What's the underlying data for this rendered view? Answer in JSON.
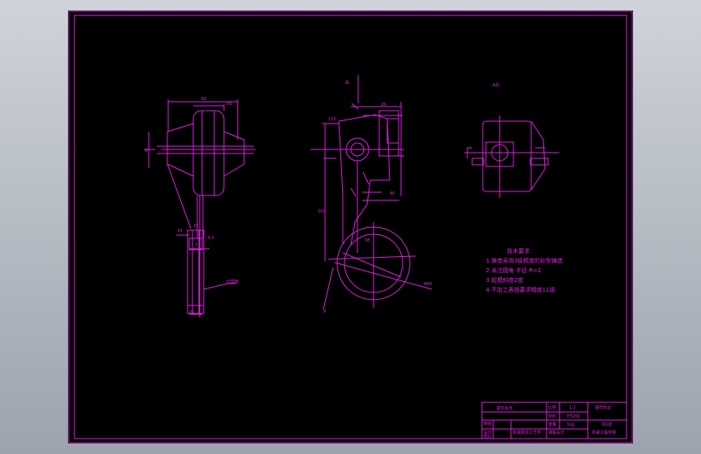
{
  "drawing": {
    "view_labels": {
      "section_a": "A",
      "view_a": "A向"
    },
    "dimensions": {
      "d_60": "60",
      "d_r5": "R5",
      "d_phi": "Φ",
      "d_14": "14",
      "d_15": "15",
      "d_3": "3",
      "d_6_5": "6.5",
      "d_25": "25",
      "d_26": "26",
      "d_100": "100",
      "d_120": "120",
      "d_40": "40",
      "d_38": "38",
      "d_phi_40": "Φ40",
      "d_r": "R",
      "plane_note": "分型面"
    },
    "tech_requirements": {
      "title": "技术要求",
      "items": [
        "1  铸造采用3级精度的砂型铸造",
        "2  未注圆角 半径 R=2",
        "3  起模斜度2度",
        "4  不加工表面要求精度11级"
      ]
    },
    "title_block": {
      "name": "拨叉毛坯",
      "r1c2": "比例",
      "r1c3": "1:1",
      "r1c4": "图样标记",
      "r2c1": "制图",
      "r2c2": "材料",
      "r2c3": "HT200",
      "r3c1": "设计",
      "r3c2": "重量",
      "r3c3": "1kg",
      "r3c4": "共1张",
      "r4c1": "校对",
      "r4c2": "机械制造工艺学",
      "r4c3": "课程设计",
      "r4c4": "机械工程学院"
    }
  }
}
